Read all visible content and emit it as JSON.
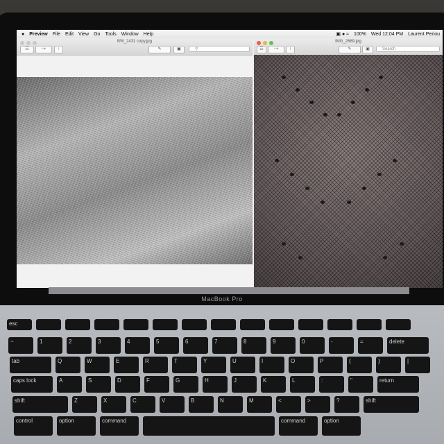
{
  "menubar": {
    "apple_icon": "apple-logo-icon",
    "app_name": "Preview",
    "items": [
      "File",
      "Edit",
      "View",
      "Go",
      "Tools",
      "Window",
      "Help"
    ],
    "battery": "100%",
    "clock": "Wed 12:04 PM",
    "user": "Laurent Periou"
  },
  "left_window": {
    "title": "BW_2431 copy.jpg",
    "photo_description_color": "#9c9c9c"
  },
  "right_window": {
    "title": "IMG_2689.jpg",
    "search_placeholder": "Search"
  },
  "laptop": {
    "brand_label": "MacBook Pro"
  },
  "keyboard": {
    "rows": [
      [
        "esc",
        "",
        "",
        "",
        "",
        "",
        "",
        "",
        "",
        "",
        "",
        "",
        "",
        ""
      ],
      [
        "~",
        "1",
        "2",
        "3",
        "4",
        "5",
        "6",
        "7",
        "8",
        "9",
        "0",
        "-",
        "=",
        "delete"
      ],
      [
        "tab",
        "Q",
        "W",
        "E",
        "R",
        "T",
        "Y",
        "U",
        "I",
        "O",
        "P",
        "{",
        "}",
        "|"
      ],
      [
        "caps lock",
        "A",
        "S",
        "D",
        "F",
        "G",
        "H",
        "J",
        "K",
        "L",
        ":",
        "\"",
        "return"
      ],
      [
        "shift",
        "Z",
        "X",
        "C",
        "V",
        "B",
        "N",
        "M",
        "<",
        ">",
        "?",
        "shift"
      ],
      [
        "control",
        "option",
        "command",
        "",
        "command",
        "option"
      ]
    ]
  }
}
